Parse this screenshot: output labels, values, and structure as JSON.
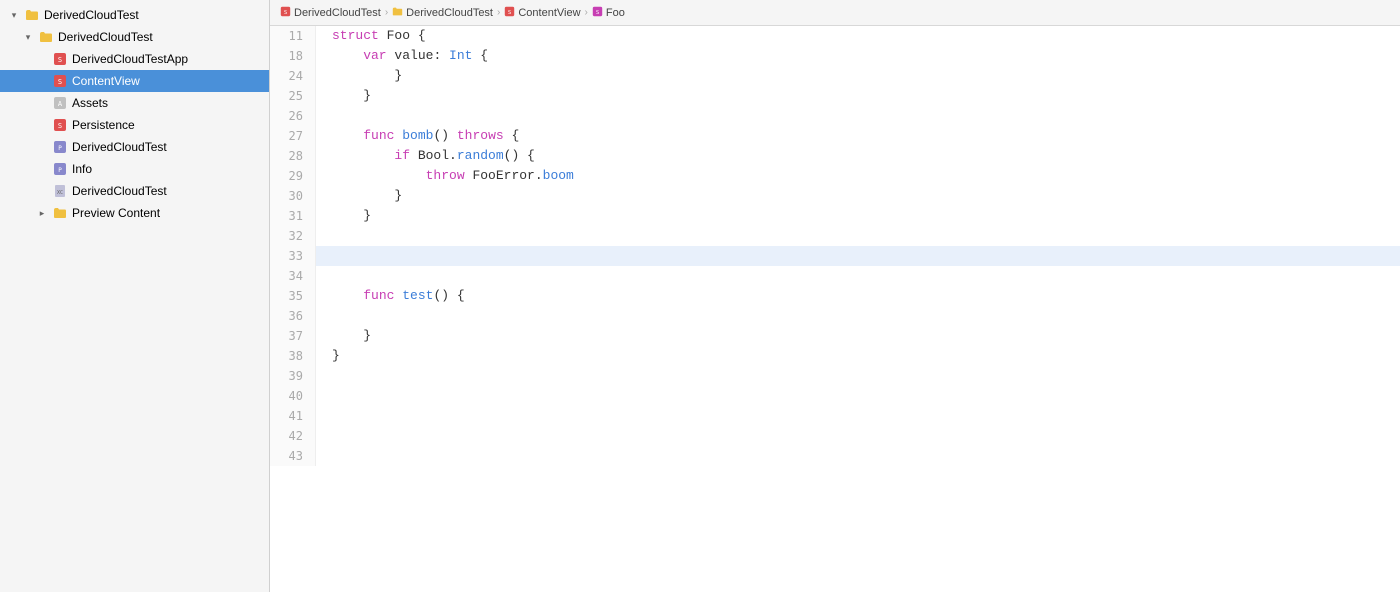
{
  "sidebar": {
    "items": [
      {
        "id": "root-group",
        "label": "DerivedCloudTest",
        "level": 0,
        "chevron": "down",
        "icon": "folder",
        "selected": false
      },
      {
        "id": "derived-cloud-test",
        "label": "DerivedCloudTest",
        "level": 1,
        "chevron": "down",
        "icon": "folder",
        "selected": false
      },
      {
        "id": "derived-cloud-test-app",
        "label": "DerivedCloudTestApp",
        "level": 2,
        "chevron": "none",
        "icon": "swift",
        "selected": false
      },
      {
        "id": "content-view",
        "label": "ContentView",
        "level": 2,
        "chevron": "none",
        "icon": "swift",
        "selected": true
      },
      {
        "id": "assets",
        "label": "Assets",
        "level": 2,
        "chevron": "none",
        "icon": "asset",
        "selected": false
      },
      {
        "id": "persistence",
        "label": "Persistence",
        "level": 2,
        "chevron": "none",
        "icon": "swift",
        "selected": false
      },
      {
        "id": "derived-cloud-test-2",
        "label": "DerivedCloudTest",
        "level": 2,
        "chevron": "none",
        "icon": "plist",
        "selected": false
      },
      {
        "id": "info",
        "label": "Info",
        "level": 2,
        "chevron": "none",
        "icon": "plist",
        "selected": false
      },
      {
        "id": "derived-cloud-test-3",
        "label": "DerivedCloudTest",
        "level": 2,
        "chevron": "none",
        "icon": "file",
        "selected": false
      },
      {
        "id": "preview-content",
        "label": "Preview Content",
        "level": 2,
        "chevron": "right",
        "icon": "folder",
        "selected": false
      }
    ]
  },
  "breadcrumb": {
    "items": [
      {
        "id": "bc-1",
        "label": "DerivedCloudTest",
        "icon": "swift-icon"
      },
      {
        "id": "bc-2",
        "label": "DerivedCloudTest",
        "icon": "folder-icon"
      },
      {
        "id": "bc-3",
        "label": "ContentView",
        "icon": "swift-icon"
      },
      {
        "id": "bc-4",
        "label": "Foo",
        "icon": "struct-icon"
      }
    ]
  },
  "code": {
    "lines": [
      {
        "num": 11,
        "highlighted": false,
        "tokens": [
          {
            "text": "struct ",
            "cls": "kw-keyword"
          },
          {
            "text": "Foo",
            "cls": ""
          },
          {
            "text": " {",
            "cls": "brace"
          }
        ]
      },
      {
        "num": 18,
        "highlighted": false,
        "tokens": [
          {
            "text": "    var ",
            "cls": "kw-keyword"
          },
          {
            "text": "value",
            "cls": ""
          },
          {
            "text": ": ",
            "cls": ""
          },
          {
            "text": "Int",
            "cls": "kw-blue"
          },
          {
            "text": " {",
            "cls": ""
          }
        ]
      },
      {
        "num": 24,
        "highlighted": false,
        "tokens": [
          {
            "text": "        }",
            "cls": ""
          }
        ]
      },
      {
        "num": 25,
        "highlighted": false,
        "tokens": [
          {
            "text": "    }",
            "cls": ""
          }
        ]
      },
      {
        "num": 26,
        "highlighted": false,
        "tokens": [
          {
            "text": "",
            "cls": ""
          }
        ]
      },
      {
        "num": 27,
        "highlighted": false,
        "tokens": [
          {
            "text": "    ",
            "cls": ""
          },
          {
            "text": "func",
            "cls": "kw-keyword"
          },
          {
            "text": " ",
            "cls": ""
          },
          {
            "text": "bomb",
            "cls": "kw-blue"
          },
          {
            "text": "() ",
            "cls": ""
          },
          {
            "text": "throws",
            "cls": "kw-throws"
          },
          {
            "text": " {",
            "cls": ""
          }
        ]
      },
      {
        "num": 28,
        "highlighted": false,
        "tokens": [
          {
            "text": "        ",
            "cls": ""
          },
          {
            "text": "if",
            "cls": "kw-keyword"
          },
          {
            "text": " Bool.",
            "cls": ""
          },
          {
            "text": "random",
            "cls": "kw-blue"
          },
          {
            "text": "() {",
            "cls": ""
          }
        ]
      },
      {
        "num": 29,
        "highlighted": false,
        "tokens": [
          {
            "text": "            ",
            "cls": ""
          },
          {
            "text": "throw",
            "cls": "kw-keyword"
          },
          {
            "text": " FooError.",
            "cls": ""
          },
          {
            "text": "boom",
            "cls": "kw-blue"
          }
        ]
      },
      {
        "num": 30,
        "highlighted": false,
        "tokens": [
          {
            "text": "        }",
            "cls": ""
          }
        ]
      },
      {
        "num": 31,
        "highlighted": false,
        "tokens": [
          {
            "text": "    }",
            "cls": ""
          }
        ]
      },
      {
        "num": 32,
        "highlighted": false,
        "tokens": [
          {
            "text": "",
            "cls": ""
          }
        ]
      },
      {
        "num": 33,
        "highlighted": true,
        "tokens": [
          {
            "text": "",
            "cls": ""
          }
        ]
      },
      {
        "num": 34,
        "highlighted": false,
        "tokens": [
          {
            "text": "",
            "cls": ""
          }
        ]
      },
      {
        "num": 35,
        "highlighted": false,
        "tokens": [
          {
            "text": "    ",
            "cls": ""
          },
          {
            "text": "func",
            "cls": "kw-keyword"
          },
          {
            "text": " ",
            "cls": ""
          },
          {
            "text": "test",
            "cls": "kw-blue"
          },
          {
            "text": "() {",
            "cls": ""
          }
        ]
      },
      {
        "num": 36,
        "highlighted": false,
        "tokens": [
          {
            "text": "",
            "cls": ""
          }
        ]
      },
      {
        "num": 37,
        "highlighted": false,
        "tokens": [
          {
            "text": "    }",
            "cls": ""
          }
        ]
      },
      {
        "num": 38,
        "highlighted": false,
        "tokens": [
          {
            "text": "}",
            "cls": ""
          }
        ]
      },
      {
        "num": 39,
        "highlighted": false,
        "tokens": [
          {
            "text": "",
            "cls": ""
          }
        ]
      },
      {
        "num": 40,
        "highlighted": false,
        "tokens": [
          {
            "text": "",
            "cls": ""
          }
        ]
      },
      {
        "num": 41,
        "highlighted": false,
        "tokens": [
          {
            "text": "",
            "cls": ""
          }
        ]
      },
      {
        "num": 42,
        "highlighted": false,
        "tokens": [
          {
            "text": "",
            "cls": ""
          }
        ]
      },
      {
        "num": 43,
        "highlighted": false,
        "tokens": [
          {
            "text": "",
            "cls": ""
          }
        ]
      }
    ]
  }
}
